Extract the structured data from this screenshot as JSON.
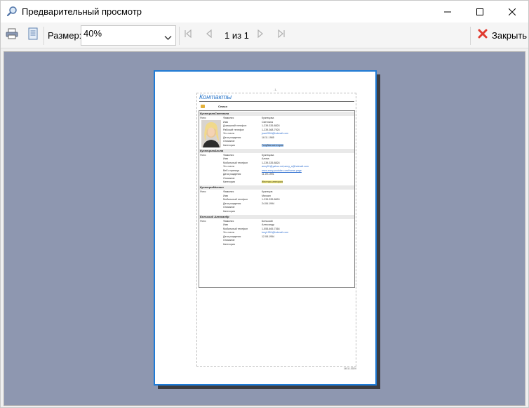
{
  "window": {
    "title": "Предварительный просмотр",
    "icon": "magnifier-icon"
  },
  "toolbar": {
    "print_icon": "printer-icon",
    "page_setup_icon": "page-setup-icon",
    "size_label": "Размер:",
    "size_value": "40%",
    "page_info": "1 из 1",
    "close_label": "Закрыть"
  },
  "report": {
    "page_number_top": "-1-",
    "title": "Контакты",
    "group_name": "Семья",
    "footer_date": "18.11.2024",
    "contacts": [
      {
        "header": "КузнецоваСветлана",
        "photo_label": "Фото:",
        "fields": [
          {
            "label": "Фамилия",
            "value": "Кузнецова",
            "style": ""
          },
          {
            "label": "Имя",
            "value": "Светлана",
            "style": ""
          },
          {
            "label": "Домашний телефон",
            "value": "1-239-335-8824",
            "style": ""
          },
          {
            "label": "Рабочий телефон",
            "value": "1-239-368-7924",
            "style": ""
          },
          {
            "label": "Эл. почта",
            "value": "joan2004@hotmail.com",
            "style": "email"
          },
          {
            "label": "Дата рождения",
            "value": "18.11.1985",
            "style": ""
          },
          {
            "label": "Описание",
            "value": "",
            "style": ""
          },
          {
            "label": "Категория",
            "value": "Голубая категория",
            "style": "cat-blue"
          }
        ]
      },
      {
        "header": "КузнецоваАлина",
        "photo_label": "Фото:",
        "fields": [
          {
            "label": "Фамилия",
            "value": "Кузнецова",
            "style": ""
          },
          {
            "label": "Имя",
            "value": "Алина",
            "style": ""
          },
          {
            "label": "Мобильный телефон",
            "value": "1-239-335-8824",
            "style": ""
          },
          {
            "label": "Эл. почта",
            "value": "anny01@yahoo.net;anny_s@hotmail.com",
            "style": "email"
          },
          {
            "label": "Веб страница",
            "value": "www.anny.youtube.com/home-page",
            "style": "link"
          },
          {
            "label": "Дата рождения",
            "value": "11.09.1991",
            "style": ""
          },
          {
            "label": "Описание",
            "value": "",
            "style": ""
          },
          {
            "label": "Категория",
            "value": "Желтая категория",
            "style": "cat-yellow"
          }
        ]
      },
      {
        "header": "КузнецовМихаил",
        "photo_label": "Фото:",
        "fields": [
          {
            "label": "Фамилия",
            "value": "Кузнецов",
            "style": ""
          },
          {
            "label": "Имя",
            "value": "Михаил",
            "style": ""
          },
          {
            "label": "Мобильный телефон",
            "value": "1-239-335-8824",
            "style": ""
          },
          {
            "label": "Дата рождения",
            "value": "24.06.1994",
            "style": ""
          },
          {
            "label": "Описание",
            "value": "",
            "style": ""
          },
          {
            "label": "Категория",
            "value": "",
            "style": ""
          }
        ]
      },
      {
        "header": "Бельский Александр",
        "photo_label": "Фото:",
        "fields": [
          {
            "label": "Фамилия",
            "value": "Бельский",
            "style": ""
          },
          {
            "label": "Имя",
            "value": "Александр",
            "style": ""
          },
          {
            "label": "Мобильный телефон",
            "value": "1-555-465-7364",
            "style": ""
          },
          {
            "label": "Эл. почта",
            "value": "tony1951@hotmail.com",
            "style": "email"
          },
          {
            "label": "Дата рождения",
            "value": "12.08.1954",
            "style": ""
          },
          {
            "label": "Описание",
            "value": "",
            "style": ""
          },
          {
            "label": "Категория",
            "value": "",
            "style": ""
          }
        ]
      }
    ]
  },
  "colors": {
    "preview_background": "#8e97b0",
    "page_border": "#1f7bd6",
    "title_color": "#2a76c9",
    "close_icon": "#e03a2f"
  }
}
